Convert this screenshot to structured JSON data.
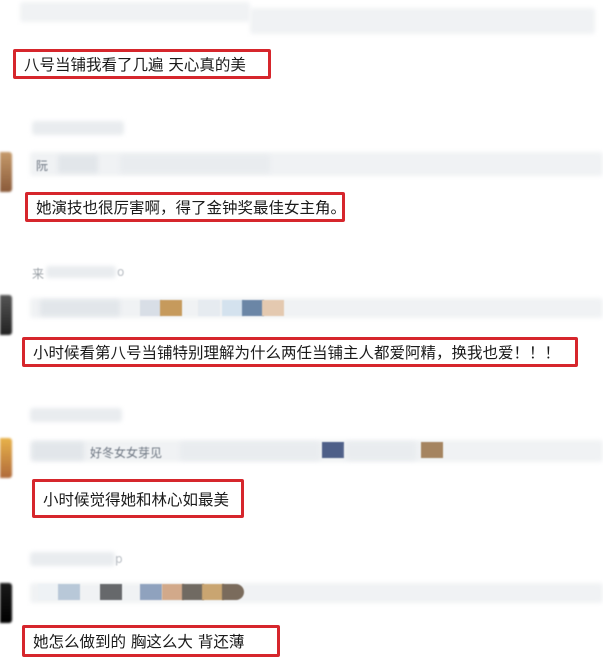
{
  "comments": [
    {
      "text": "八号当铺我看了几遍 天心真的美"
    },
    {
      "text": "她演技也很厉害啊，得了金钟奖最佳女主角。"
    },
    {
      "text": "小时候看第八号当铺特别理解为什么两任当铺主人都爱阿精，换我也爱！！！"
    },
    {
      "text": "小时候觉得她和林心如最美"
    },
    {
      "text": "她怎么做到的 胸这么大 背还薄"
    }
  ],
  "obscured": {
    "user2": "来",
    "user2_suffix": "o",
    "user3": "来",
    "user3_suffix": "o",
    "user5_suffix": "p",
    "quote2": "阮",
    "quote4": "好冬女女芽见"
  },
  "colors": {
    "highlight_border": "#d6262c",
    "blur_gray": "#e9ecef"
  }
}
